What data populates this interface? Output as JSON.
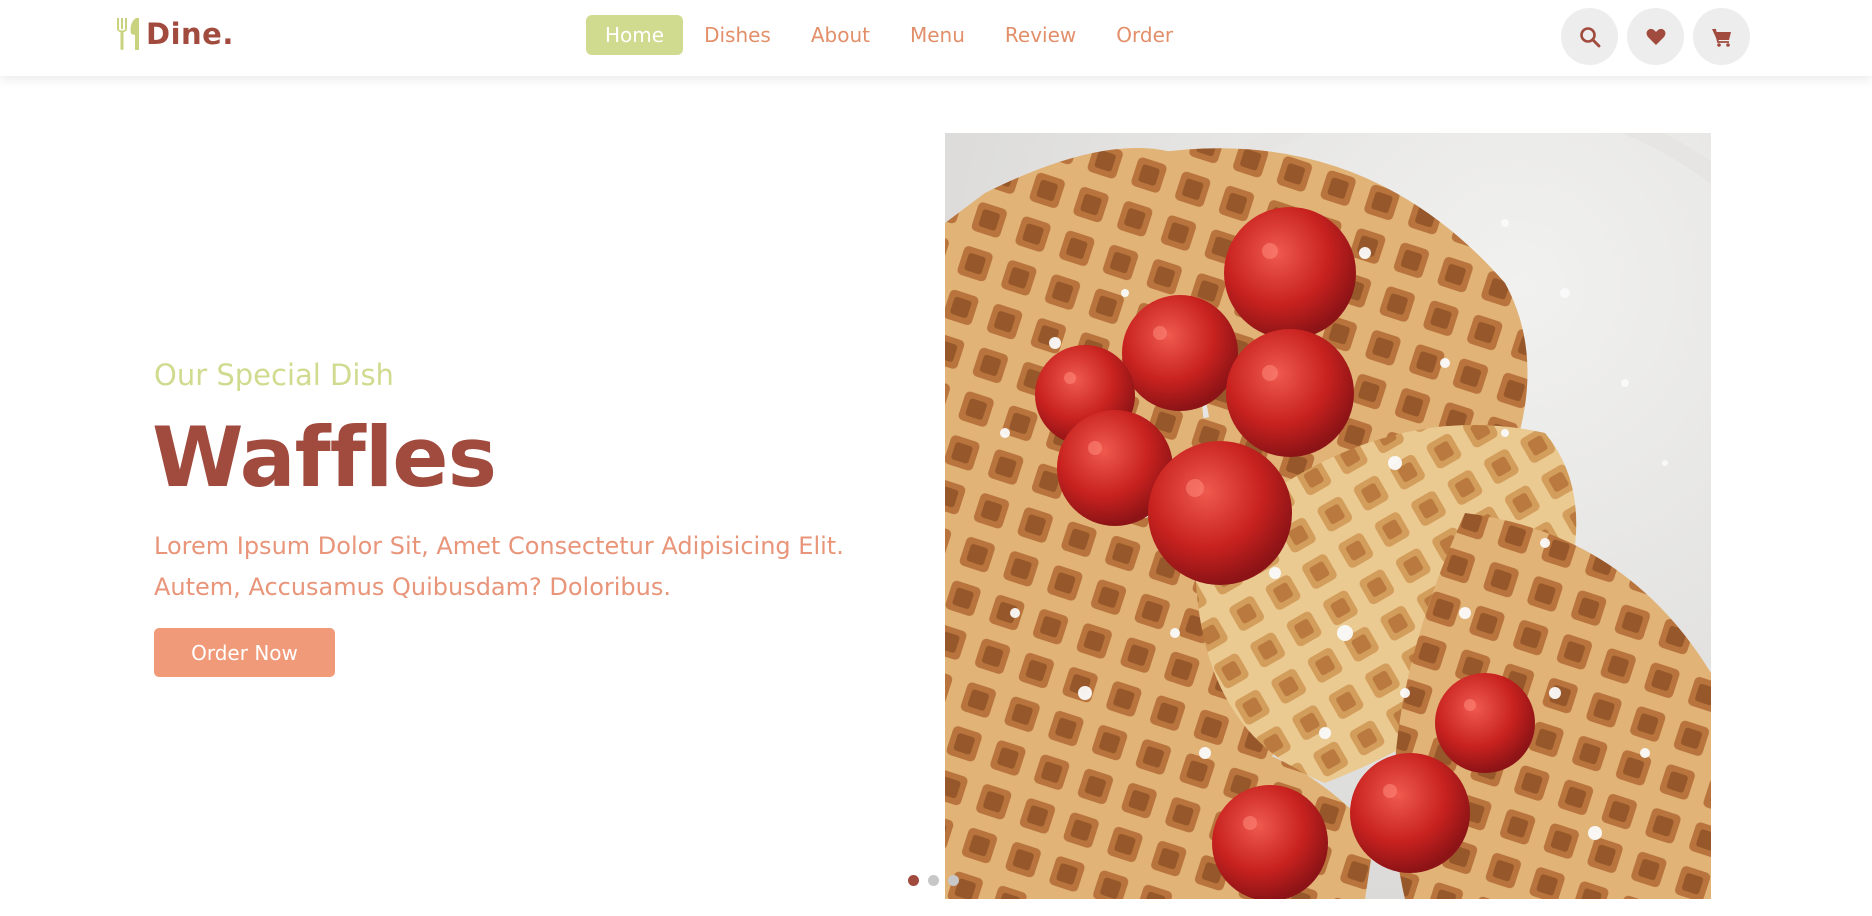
{
  "header": {
    "logo_text": "Dine.",
    "logo_icon": "utensils-icon",
    "nav": [
      {
        "label": "Home",
        "active": true
      },
      {
        "label": "Dishes",
        "active": false
      },
      {
        "label": "About",
        "active": false
      },
      {
        "label": "Menu",
        "active": false
      },
      {
        "label": "Review",
        "active": false
      },
      {
        "label": "Order",
        "active": false
      }
    ],
    "actions": [
      "search-icon",
      "heart-icon",
      "cart-icon"
    ]
  },
  "hero": {
    "subtitle": "Our Special Dish",
    "title": "Waffles",
    "description": "Lorem Ipsum Dolor Sit, Amet Consectetur Adipisicing Elit. Autem, Accusamus Quibusdam? Doloribus.",
    "button_label": "Order Now",
    "image": "waffles-with-raspberries",
    "slides": {
      "count": 3,
      "active": 1
    }
  },
  "colors": {
    "brand": "#a14a3e",
    "accent_green": "#d1db8f",
    "accent_orange": "#f09a79",
    "nav_text": "#e28f6a"
  }
}
